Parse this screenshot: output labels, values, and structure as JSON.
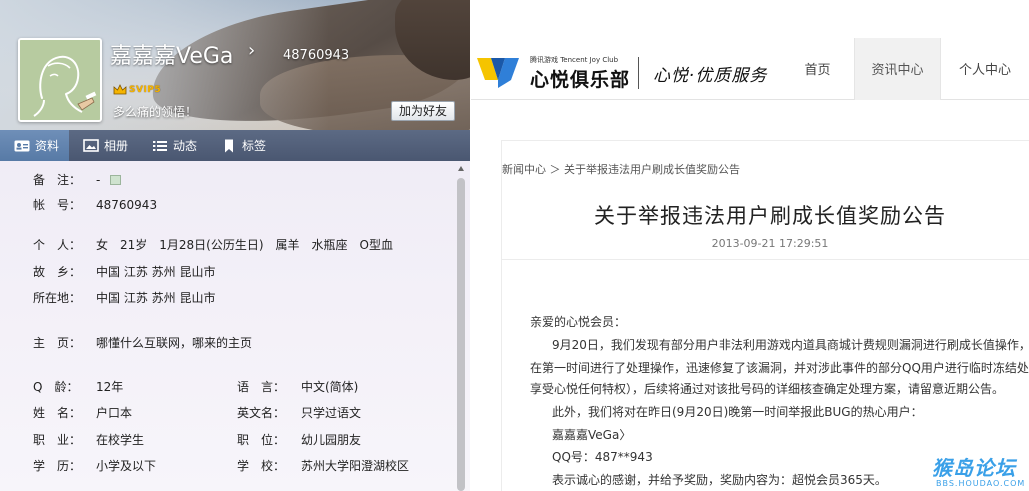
{
  "qq_profile": {
    "nickname": "嘉嘉嘉VeGa",
    "nickname_arrow": "›",
    "qq_number": "48760943",
    "vip_badge": "SVIP5",
    "signature": "多么痛的领悟！",
    "add_friend_button": "加为好友",
    "tabs": [
      {
        "label": "资料",
        "icon": "id-card-icon",
        "active": true
      },
      {
        "label": "相册",
        "icon": "photo-album-icon",
        "active": false
      },
      {
        "label": "动态",
        "icon": "feed-list-icon",
        "active": false
      },
      {
        "label": "标签",
        "icon": "bookmark-icon",
        "active": false
      }
    ],
    "info": {
      "remark": {
        "label": "备　注：",
        "value": "-"
      },
      "account": {
        "label": "帐　号：",
        "value": "48760943"
      },
      "personal": {
        "label": "个　人：",
        "value": "女　21岁　1月28日(公历生日)　属羊　水瓶座　O型血"
      },
      "hometown": {
        "label": "故　乡：",
        "value": "中国 江苏 苏州 昆山市"
      },
      "location": {
        "label": "所在地：",
        "value": "中国 江苏 苏州 昆山市"
      },
      "homepage": {
        "label": "主　页：",
        "value": "哪懂什么互联网，哪来的主页"
      },
      "q_age": {
        "label": "Q　龄：",
        "value": "12年"
      },
      "language": {
        "label": "语　言：",
        "value": "中文(简体)"
      },
      "surname": {
        "label": "姓　名：",
        "value": "户口本"
      },
      "english_name": {
        "label": "英文名：",
        "value": "只学过语文"
      },
      "occupation": {
        "label": "职　业：",
        "value": "在校学生"
      },
      "position": {
        "label": "职　位：",
        "value": "幼儿园朋友"
      },
      "education": {
        "label": "学　历：",
        "value": "小学及以下"
      },
      "school": {
        "label": "学　校：",
        "value": "苏州大学阳澄湖校区"
      }
    }
  },
  "joy_club": {
    "brand_small": "腾讯游戏 Tencent Joy Club",
    "brand_name": "心悦俱乐部",
    "slogan": "心悦·优质服务",
    "nav": [
      {
        "label": "首页",
        "active": false
      },
      {
        "label": "资讯中心",
        "active": true
      },
      {
        "label": "个人中心",
        "active": false
      }
    ],
    "breadcrumb": "新闻中心 ＞ 关于举报违法用户刷成长值奖励公告",
    "article_title": "关于举报违法用户刷成长值奖励公告",
    "article_date": "2013-09-21 17:29:51",
    "paragraphs": {
      "greeting": "亲爱的心悦会员：",
      "p1_line1": "9月20日，我们发现有部分用户非法利用游戏内道具商城计费规则漏洞进行刷成长值操作，对此",
      "p1_line2": "在第一时间进行了处理操作，迅速修复了该漏洞，并对涉此事件的部分QQ用户进行临时冻结处理（",
      "p1_line3": "享受心悦任何特权），后续将通过对该批号码的详细核查确定处理方案，请留意近期公告。",
      "p2": "此外，我们将对在昨日(9月20日)晚第一时间举报此BUG的热心用户：",
      "reporter_name": "嘉嘉嘉VeGa〉",
      "reporter_qq": "QQ号：487**943",
      "reward": "表示诚心的感谢，并给予奖励，奖励内容为：超悦会员365天。"
    },
    "watermark_main": "猴岛论坛",
    "watermark_url": "BBS.HOUDAO.COM"
  },
  "colors": {
    "qq_tab_bar": "#4f5c78",
    "qq_tab_active": "#6386b1",
    "vip_gold": "#f5b400",
    "logo_blue": "#2f7fd8",
    "logo_yellow": "#f5c400",
    "watermark": "#3aa0e8"
  }
}
